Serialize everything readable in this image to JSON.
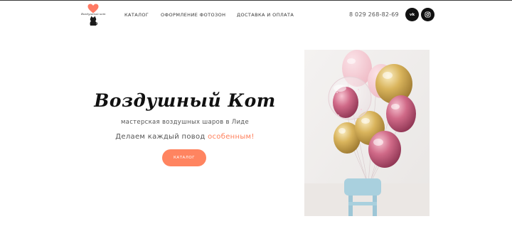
{
  "header": {
    "logo": {
      "text": "Воздушный кот",
      "heart_color": "#ff7a64"
    },
    "nav": [
      {
        "label": "КАТАЛОГ"
      },
      {
        "label": "ОФОРМЛЕНИЕ ФОТОЗОН"
      },
      {
        "label": "ДОСТАВКА И ОПЛАТА"
      }
    ],
    "phone": "8 029 268-82-69",
    "social": [
      {
        "name": "vk-icon",
        "label": "vk"
      },
      {
        "name": "instagram-icon",
        "label": ""
      }
    ]
  },
  "hero": {
    "title": "Воздушный Кот",
    "subtitle": "мастерская воздушных шаров в Лиде",
    "tagline_prefix": "Делаем каждый повод ",
    "tagline_accent": "особенным",
    "tagline_suffix": "!",
    "cta_label": "КАТАЛОГ",
    "accent_color": "#ff7f5a",
    "button_color": "#ff8460"
  }
}
